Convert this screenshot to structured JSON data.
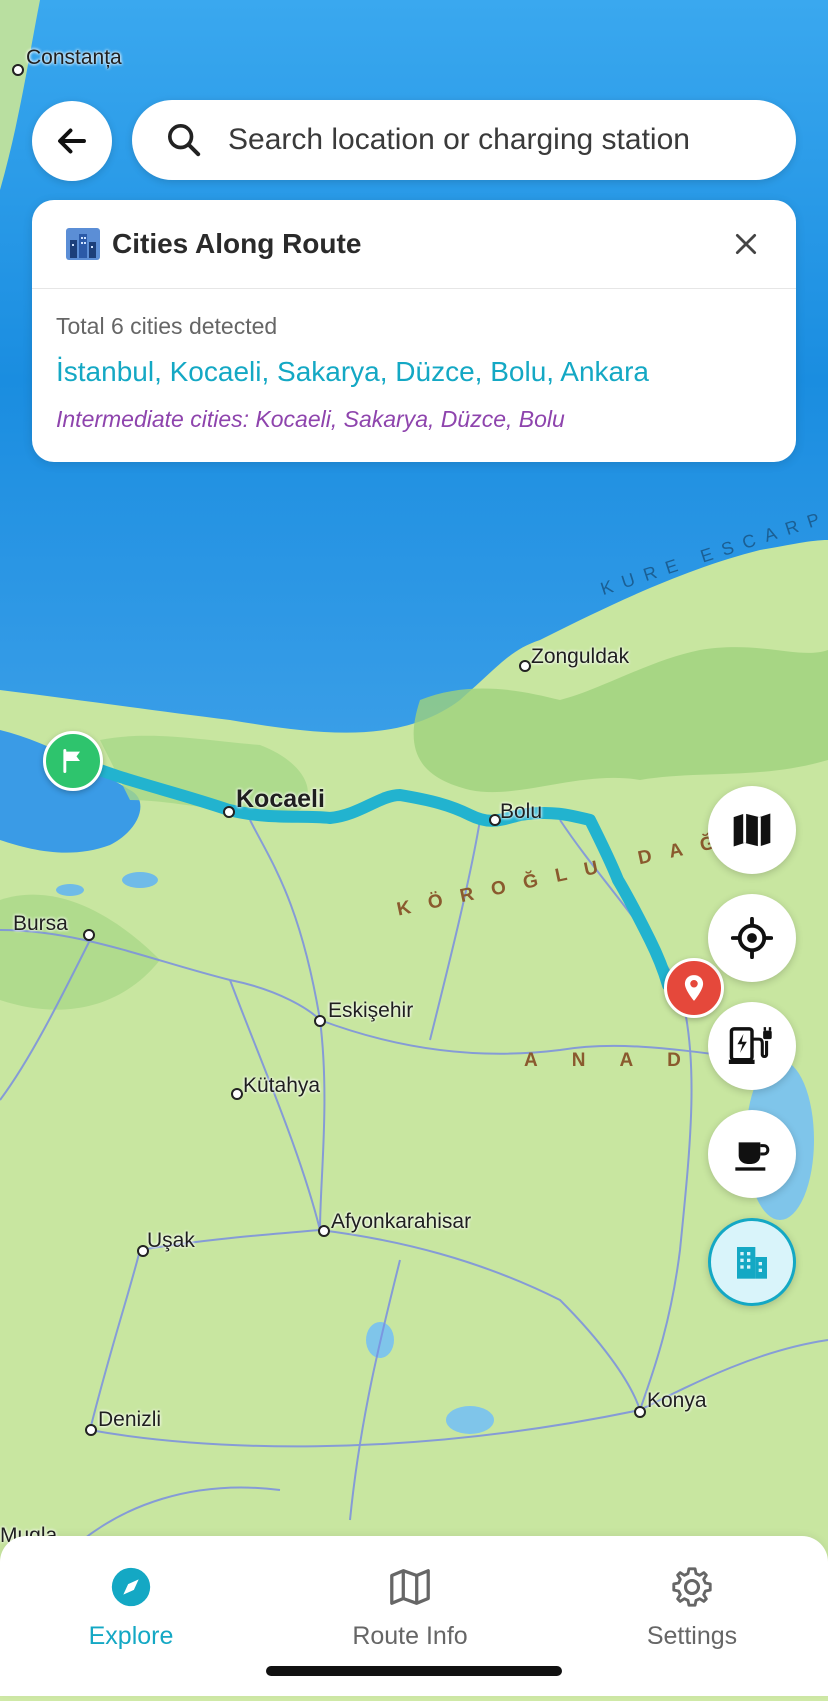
{
  "map": {
    "labels": {
      "constanta": "Constanța",
      "zonguldak": "Zonguldak",
      "kocaeli": "Kocaeli",
      "bolu": "Bolu",
      "bursa": "Bursa",
      "eskisehir": "Eskişehir",
      "kutahya": "Kütahya",
      "afyonkarahisar": "Afyonkarahisar",
      "usak": "Uşak",
      "denizli": "Denizli",
      "konya": "Konya",
      "mugla": "Mugla",
      "koroglu": "KÖROĞLU DAĞ",
      "anadolu": "ANAD",
      "kure": "KURE ESCARP"
    },
    "route_color": "#22b3cf",
    "start_marker_icon": "flag-icon",
    "end_marker_icon": "location-pin-icon"
  },
  "search": {
    "placeholder": "Search location or charging station"
  },
  "cities_card": {
    "title": "Cities Along Route",
    "total": "Total 6 cities detected",
    "cities": "İstanbul, Kocaeli, Sakarya, Düzce, Bolu, Ankara",
    "intermediate": "Intermediate cities: Kocaeli, Sakarya, Düzce, Bolu"
  },
  "fabs": [
    "map-layers-icon",
    "locate-icon",
    "ev-charger-icon",
    "coffee-icon",
    "city-buildings-icon"
  ],
  "nav": {
    "explore": "Explore",
    "route_info": "Route Info",
    "settings": "Settings"
  },
  "colors": {
    "accent": "#14a8c4",
    "intermediate_text": "#8e44ad",
    "start_marker": "#2ec46d",
    "end_marker": "#e5483b"
  }
}
